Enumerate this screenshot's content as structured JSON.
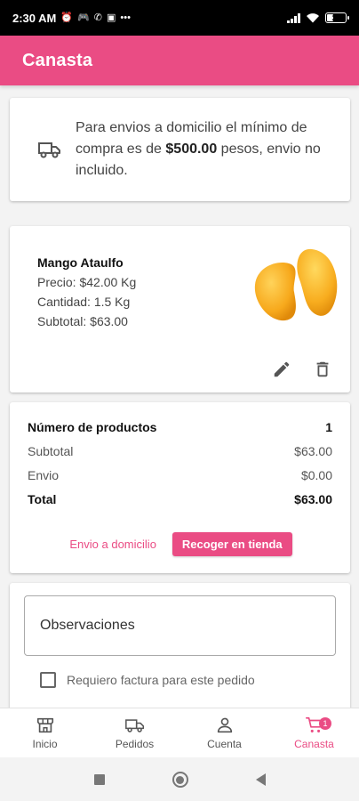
{
  "status_bar": {
    "time": "2:30 AM",
    "battery": "32",
    "battery_level": 0.32
  },
  "app_bar": {
    "title": "Canasta"
  },
  "notice": {
    "text_before": "Para envios a domicilio el mínimo de compra es de ",
    "amount": "$500.00",
    "text_after": " pesos, envio no incluido."
  },
  "product": {
    "name": "Mango Ataulfo",
    "price": "Precio: $42.00 Kg",
    "quantity": "Cantidad: 1.5 Kg",
    "subtotal": "Subtotal: $63.00"
  },
  "summary": {
    "rows": [
      {
        "label": "Número de productos",
        "value": "1"
      },
      {
        "label": "Subtotal",
        "value": "$63.00"
      },
      {
        "label": "Envio",
        "value": "$0.00"
      },
      {
        "label": "Total",
        "value": "$63.00"
      }
    ],
    "delivery_label": "Envio a domicilio",
    "pickup_label": "Recoger en tienda"
  },
  "notes": {
    "observations_placeholder": "Observaciones",
    "invoice_label": "Requiero factura para este pedido"
  },
  "bottom_nav": {
    "items": [
      {
        "label": "Inicio",
        "icon": "store-icon"
      },
      {
        "label": "Pedidos",
        "icon": "truck-icon"
      },
      {
        "label": "Cuenta",
        "icon": "person-icon"
      },
      {
        "label": "Canasta",
        "icon": "cart-icon",
        "badge": "1"
      }
    ]
  },
  "colors": {
    "accent": "#ea4c84",
    "status_bar": "#000000",
    "background": "#f3f3f3"
  }
}
